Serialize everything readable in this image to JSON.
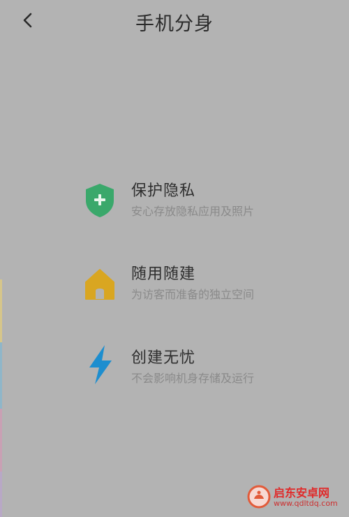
{
  "header": {
    "title": "手机分身",
    "back_icon": "chevron-left-icon"
  },
  "features": [
    {
      "title": "保护隐私",
      "subtitle": "安心存放隐私应用及照片",
      "icon": "shield-plus-icon",
      "color": "#3aa86b"
    },
    {
      "title": "随用随建",
      "subtitle": "为访客而准备的独立空间",
      "icon": "house-icon",
      "color": "#d9a621"
    },
    {
      "title": "创建无忧",
      "subtitle": "不会影响机身存储及运行",
      "icon": "lightning-icon",
      "color": "#1d8ecf"
    }
  ],
  "watermark": {
    "name": "启东安卓网",
    "url": "www.qdltdq.com",
    "color": "#e02a2a"
  },
  "colors": {
    "background": "#b3b3b3",
    "title_text": "#2e2e2e",
    "subtitle_text": "#8a8a8a"
  }
}
